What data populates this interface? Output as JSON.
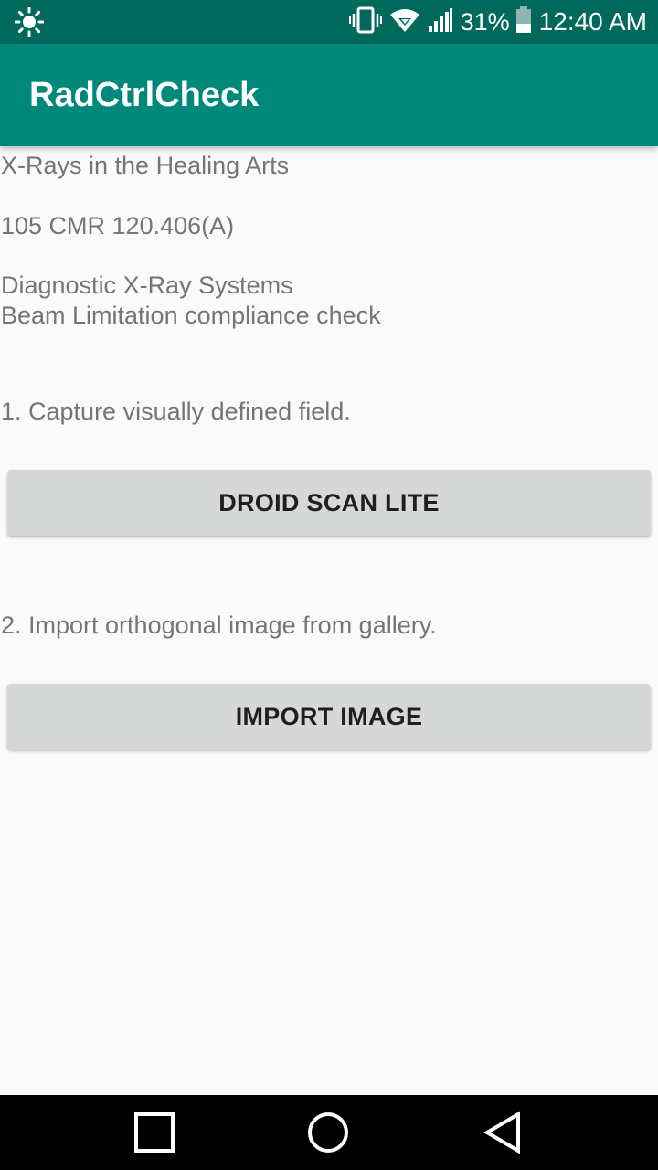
{
  "status_bar": {
    "left_icon": "brightness-icon",
    "icons": [
      "vibrate-icon",
      "wifi-icon",
      "signal-icon",
      "battery-icon"
    ],
    "battery_percent": "31%",
    "time": "12:40 AM",
    "background": "#00695c"
  },
  "app_bar": {
    "title": "RadCtrlCheck",
    "background": "#00897b"
  },
  "content": {
    "heading": "X-Rays in the Healing Arts",
    "regulation": "105 CMR 120.406(A)",
    "description_line1": "Diagnostic X-Ray Systems",
    "description_line2": "Beam Limitation compliance check",
    "step1_text": "1. Capture visually defined field.",
    "step1_button": "DROID SCAN LITE",
    "step2_text": "2. Import orthogonal image from gallery.",
    "step2_button": "IMPORT IMAGE"
  },
  "nav_bar": {
    "buttons": [
      "recents-icon",
      "home-icon",
      "back-icon"
    ]
  }
}
